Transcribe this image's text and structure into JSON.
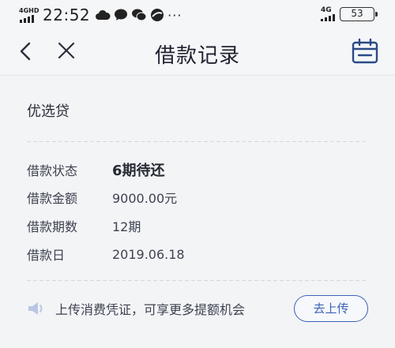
{
  "status_bar": {
    "network_left": "4GHD",
    "time": "22:52",
    "network_right": "4G",
    "battery": "53"
  },
  "nav": {
    "title": "借款记录"
  },
  "loan": {
    "product_name": "优选贷",
    "rows": [
      {
        "label": "借款状态",
        "value": "6期待还"
      },
      {
        "label": "借款金额",
        "value": "9000.00元"
      },
      {
        "label": "借款期数",
        "value": "12期"
      },
      {
        "label": "借款日",
        "value": "2019.06.18"
      }
    ]
  },
  "promo": {
    "text": "上传消费凭证，可享更多提额机会",
    "button_label": "去上传"
  },
  "colors": {
    "accent": "#3b63b8",
    "background": "#f3f4f6"
  }
}
